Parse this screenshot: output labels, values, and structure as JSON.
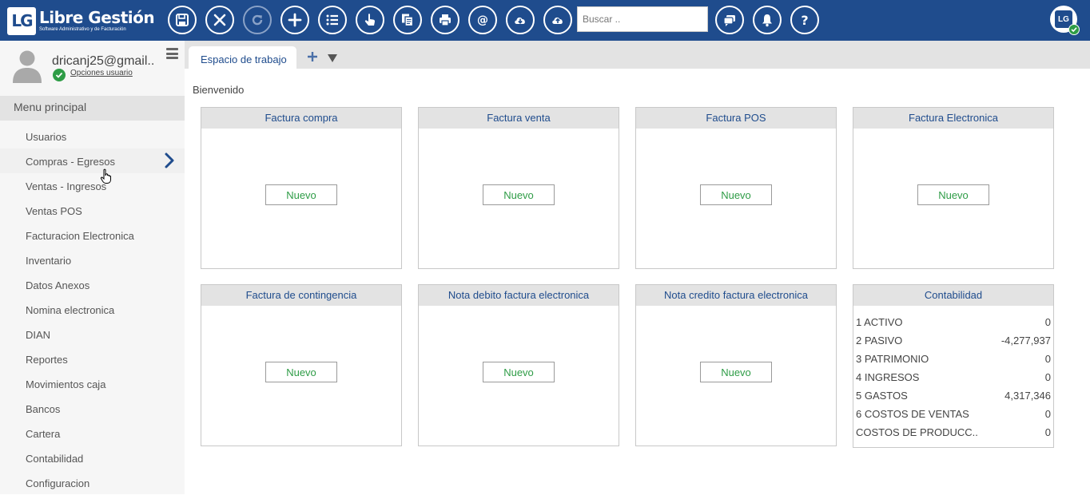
{
  "app": {
    "logo_mark": "LG",
    "title": "Libre Gestión",
    "subtitle": "Software Administrativo y de Facturación"
  },
  "toolbar": {
    "buttons": [
      "save",
      "close",
      "refresh",
      "add",
      "list",
      "touch",
      "copy",
      "print",
      "email",
      "download",
      "upload"
    ],
    "search_placeholder": "Buscar .."
  },
  "user": {
    "name": "dricanj25@gmail..",
    "options_label": "Opciones usuario",
    "top_badge": "LG"
  },
  "sidebar": {
    "header": "Menu principal",
    "items": [
      {
        "label": "Usuarios"
      },
      {
        "label": "Compras - Egresos"
      },
      {
        "label": "Ventas - Ingresos"
      },
      {
        "label": "Ventas POS"
      },
      {
        "label": "Facturacion Electronica"
      },
      {
        "label": "Inventario"
      },
      {
        "label": "Datos Anexos"
      },
      {
        "label": "Nomina electronica"
      },
      {
        "label": "DIAN"
      },
      {
        "label": "Reportes"
      },
      {
        "label": "Movimientos caja"
      },
      {
        "label": "Bancos"
      },
      {
        "label": "Cartera"
      },
      {
        "label": "Contabilidad"
      },
      {
        "label": "Configuracion"
      }
    ]
  },
  "tabs": [
    {
      "label": "Espacio de trabajo"
    }
  ],
  "main": {
    "welcome": "Bienvenido",
    "cards": [
      {
        "title": "Factura compra",
        "button": "Nuevo"
      },
      {
        "title": "Factura venta",
        "button": "Nuevo"
      },
      {
        "title": "Factura POS",
        "button": "Nuevo"
      },
      {
        "title": "Factura Electronica",
        "button": "Nuevo"
      },
      {
        "title": "Factura de contingencia",
        "button": "Nuevo"
      },
      {
        "title": "Nota debito factura electronica",
        "button": "Nuevo"
      },
      {
        "title": "Nota credito factura electronica",
        "button": "Nuevo"
      }
    ],
    "accounting": {
      "title": "Contabilidad",
      "rows": [
        {
          "label": "1 ACTIVO",
          "value": "0"
        },
        {
          "label": "2 PASIVO",
          "value": "-4,277,937"
        },
        {
          "label": "3 PATRIMONIO",
          "value": "0"
        },
        {
          "label": "4 INGRESOS",
          "value": "0"
        },
        {
          "label": "5 GASTOS",
          "value": "4,317,346"
        },
        {
          "label": "6 COSTOS DE VENTAS",
          "value": "0"
        },
        {
          "label": "COSTOS DE PRODUCC..",
          "value": "0"
        }
      ]
    }
  },
  "colors": {
    "brand": "#1f4c8d",
    "success": "#2e9c46",
    "panel": "#e3e3e3"
  }
}
